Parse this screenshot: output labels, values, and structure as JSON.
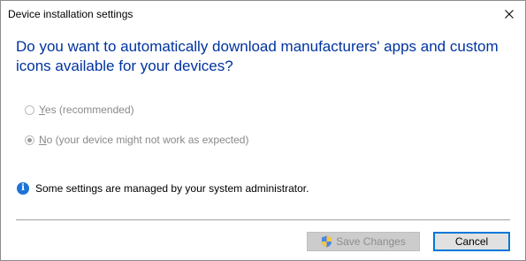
{
  "window": {
    "title": "Device installation settings"
  },
  "question": "Do you want to automatically download manufacturers' apps and custom icons available for your devices?",
  "options": [
    {
      "accel": "Y",
      "rest": "es (recommended)",
      "selected": false,
      "disabled": true
    },
    {
      "accel": "N",
      "rest": "o (your device might not work as expected)",
      "selected": true,
      "disabled": true
    }
  ],
  "info": {
    "icon": "info-icon",
    "text": "Some settings are managed by your system administrator."
  },
  "buttons": {
    "save_label": "Save Changes",
    "save_icon": "uac-shield-icon",
    "save_disabled": true,
    "cancel_label": "Cancel"
  },
  "colors": {
    "heading": "#0033a0",
    "accent": "#0078d7",
    "info_icon": "#1e73d8"
  }
}
